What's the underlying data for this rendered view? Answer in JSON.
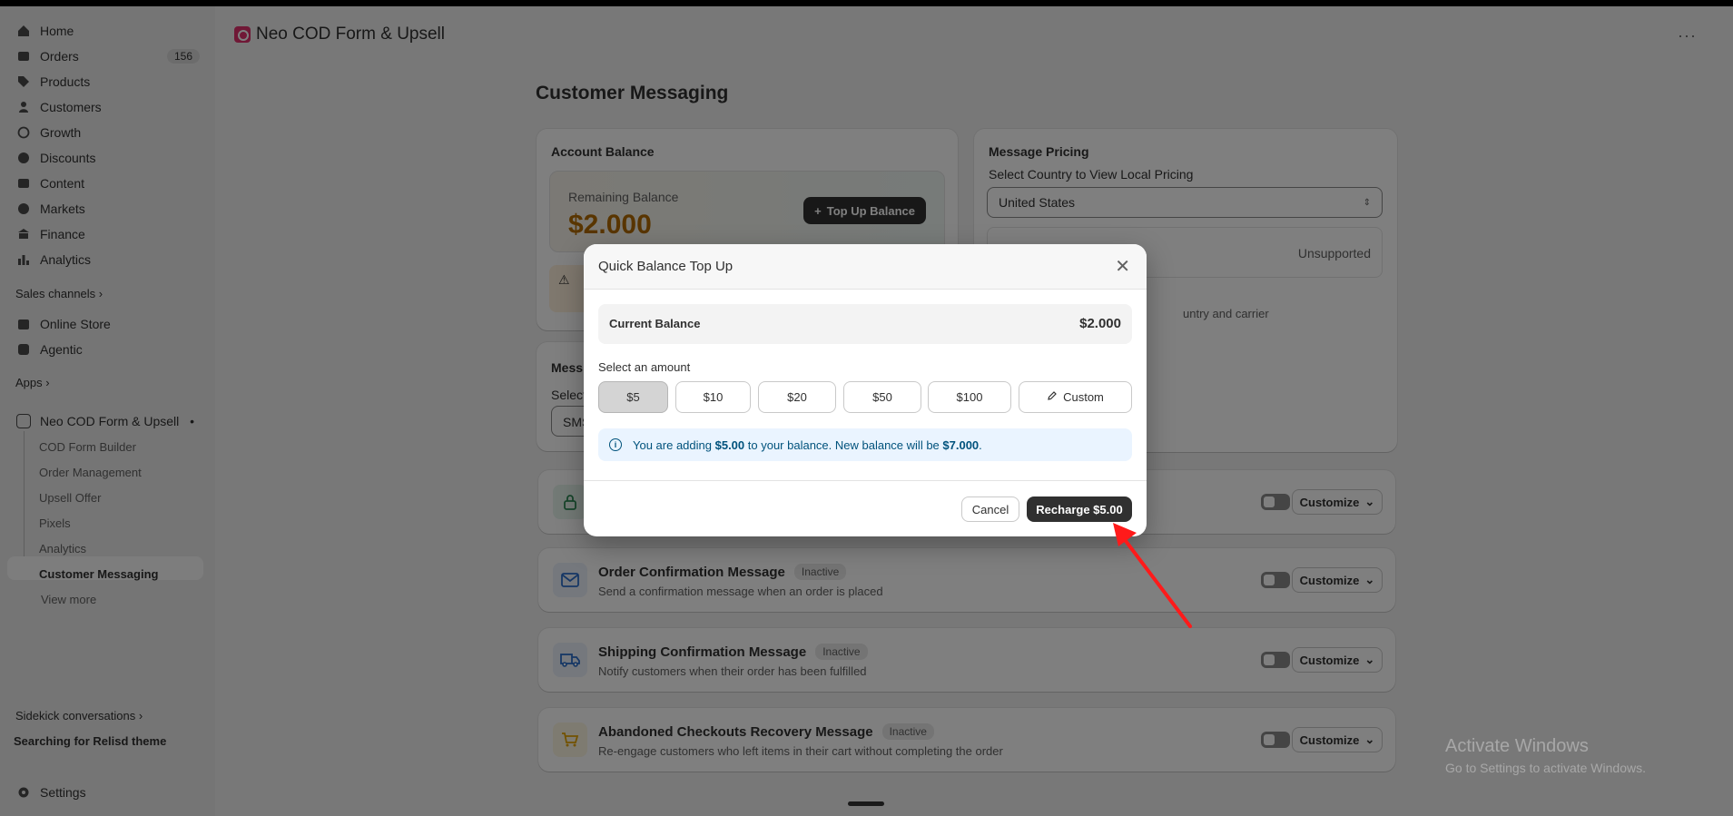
{
  "sidebar": {
    "items": [
      {
        "label": "Home",
        "icon": "home-icon"
      },
      {
        "label": "Orders",
        "icon": "inbox-icon",
        "badge": "156"
      },
      {
        "label": "Products",
        "icon": "tag-icon"
      },
      {
        "label": "Customers",
        "icon": "person-icon"
      },
      {
        "label": "Growth",
        "icon": "growth-icon"
      },
      {
        "label": "Discounts",
        "icon": "discount-icon"
      },
      {
        "label": "Content",
        "icon": "content-icon"
      },
      {
        "label": "Markets",
        "icon": "globe-icon"
      },
      {
        "label": "Finance",
        "icon": "bank-icon"
      },
      {
        "label": "Analytics",
        "icon": "bar-chart-icon"
      }
    ],
    "sales_channels_label": "Sales channels",
    "channels": [
      {
        "label": "Online Store",
        "icon": "store-icon"
      },
      {
        "label": "Agentic",
        "icon": "agentic-icon"
      }
    ],
    "apps_label": "Apps",
    "app_name": "Neo COD Form & Upsell",
    "app_subitems": [
      "COD Form Builder",
      "Order Management",
      "Upsell Offer",
      "Pixels",
      "Analytics",
      "Customer Messaging"
    ],
    "view_more": "View more",
    "sidekick_label": "Sidekick conversations",
    "sidekick_item": "Searching for Relisd theme",
    "settings_label": "Settings"
  },
  "header": {
    "app_title": "Neo COD Form & Upsell",
    "more": "···"
  },
  "page": {
    "title": "Customer Messaging"
  },
  "account_balance": {
    "title": "Account Balance",
    "remaining_label": "Remaining Balance",
    "remaining_value": "$2.000",
    "topup_label": "Top Up Balance"
  },
  "message_pricing": {
    "title": "Message Pricing",
    "select_label": "Select Country to View Local Pricing",
    "selected_country": "United States",
    "status": "Unsupported",
    "note_fragment": "untry and carrier"
  },
  "partial_card": {
    "title_fragment": "Mess",
    "select_fragment": "Select",
    "value_fragment": "SMS"
  },
  "messages": [
    {
      "title": "Order Confirmation Message",
      "status": "Inactive",
      "desc": "Send a confirmation message when an order is placed",
      "icon": "mail-icon",
      "color": "#2c6ecb",
      "bg": "#eaf1fb"
    },
    {
      "title": "Shipping Confirmation Message",
      "status": "Inactive",
      "desc": "Notify customers when their order has been fulfilled",
      "icon": "truck-icon",
      "color": "#2c6ecb",
      "bg": "#eaf1fb"
    },
    {
      "title": "Abandoned Checkouts Recovery Message",
      "status": "Inactive",
      "desc": "Re-engage customers who left items in their cart without completing the order",
      "icon": "cart-icon",
      "color": "#e5a400",
      "bg": "#fdf6e3"
    }
  ],
  "customize_label": "Customize",
  "modal": {
    "title": "Quick Balance Top Up",
    "current_balance_label": "Current Balance",
    "current_balance_value": "$2.000",
    "select_amount_label": "Select an amount",
    "amounts": [
      "$5",
      "$10",
      "$20",
      "$50",
      "$100"
    ],
    "custom_label": "Custom",
    "selected_amount": "$5",
    "info": {
      "prefix": "You are adding ",
      "amount": "$5.00",
      "middle": " to your balance. New balance will be ",
      "new_balance": "$7.000",
      "suffix": "."
    },
    "cancel_label": "Cancel",
    "recharge_label": "Recharge $5.00"
  },
  "windows_watermark": {
    "line1": "Activate Windows",
    "line2": "Go to Settings to activate Windows."
  },
  "colors": {
    "accent_dark": "#303030",
    "balance_orange": "#b36b00",
    "info_blue": "#00527c",
    "arrow_red": "#ff1a1a"
  }
}
